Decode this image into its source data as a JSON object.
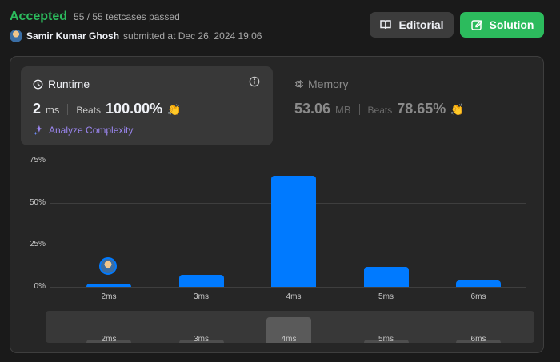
{
  "status": {
    "result": "Accepted",
    "testcases": "55 / 55 testcases passed"
  },
  "submission": {
    "user": "Samir Kumar Ghosh",
    "submitted_text": "submitted at Dec 26, 2024 19:06"
  },
  "buttons": {
    "editorial": "Editorial",
    "solution": "Solution"
  },
  "runtime": {
    "title": "Runtime",
    "value": "2",
    "unit": "ms",
    "beats_label": "Beats",
    "beats": "100.00%",
    "analyze": "Analyze Complexity"
  },
  "memory": {
    "title": "Memory",
    "value": "53.06",
    "unit": "MB",
    "beats_label": "Beats",
    "beats": "78.65%"
  },
  "colors": {
    "accent": "#2cbb5d",
    "bar": "#007aff",
    "analyze": "#9b86f0"
  },
  "icons": [
    "book-icon",
    "edit-icon",
    "clock-icon",
    "info-icon",
    "sparkle-icon",
    "chip-icon",
    "clap-icon"
  ],
  "chart_data": {
    "type": "bar",
    "categories": [
      "2ms",
      "3ms",
      "4ms",
      "5ms",
      "6ms"
    ],
    "values": [
      2,
      7,
      66,
      12,
      4
    ],
    "y_ticks": [
      "75%",
      "50%",
      "25%",
      "0%"
    ],
    "ylim": [
      0,
      75
    ],
    "grid": true,
    "selected_category": "2ms",
    "slider_labels": [
      "2ms",
      "3ms",
      "4ms",
      "5ms",
      "6ms"
    ],
    "slider_selected": "4ms"
  }
}
